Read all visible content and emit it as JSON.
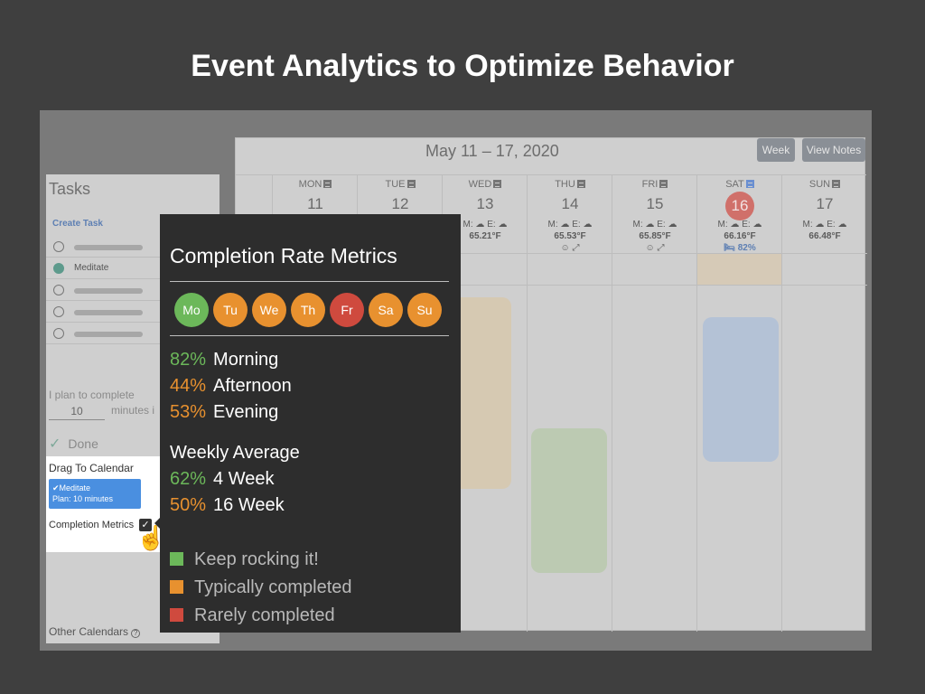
{
  "slide_title": "Event Analytics to Optimize Behavior",
  "colors": {
    "green": "#6cb85a",
    "orange": "#e8912f",
    "red": "#cf4a3e"
  },
  "calendar": {
    "title": "May 11 – 17, 2020",
    "week_button": "Week",
    "view_notes_button": "View Notes",
    "days": [
      {
        "name": "MON",
        "num": "11",
        "weather": "",
        "temp": "",
        "extra": ""
      },
      {
        "name": "TUE",
        "num": "12",
        "weather": "",
        "temp": "",
        "extra": ""
      },
      {
        "name": "WED",
        "num": "13",
        "weather": "M: ☁ E: ☁",
        "temp": "65.21°F",
        "extra": ""
      },
      {
        "name": "THU",
        "num": "14",
        "weather": "M: ☁ E: ☁",
        "temp": "65.53°F",
        "extra": "☺ ⤢"
      },
      {
        "name": "FRI",
        "num": "15",
        "weather": "M: ☁ E: ☁",
        "temp": "65.85°F",
        "extra": "☺ ⤢"
      },
      {
        "name": "SAT",
        "num": "16",
        "weather": "M: ☁ E: ☁",
        "temp": "66.16°F",
        "extra": "🛏 82%"
      },
      {
        "name": "SUN",
        "num": "17",
        "weather": "M: ☁ E: ☁",
        "temp": "66.48°F",
        "extra": ""
      }
    ]
  },
  "sidebar": {
    "title": "Tasks",
    "create_task": "Create Task",
    "task_item": "Meditate",
    "plan_text": "I plan to complete",
    "plan_value": "10",
    "plan_unit": "minutes i",
    "done": "Done",
    "drag_title": "Drag To Calendar",
    "drag_card_line1": "✔Meditate",
    "drag_card_line2": "Plan: 10 minutes",
    "completion_metrics": "Completion Metrics",
    "other_calendars": "Other Calendars"
  },
  "popup": {
    "title": "Completion Rate Metrics",
    "days": [
      {
        "label": "Mo",
        "status": "green"
      },
      {
        "label": "Tu",
        "status": "orange"
      },
      {
        "label": "We",
        "status": "orange"
      },
      {
        "label": "Th",
        "status": "orange"
      },
      {
        "label": "Fr",
        "status": "red"
      },
      {
        "label": "Sa",
        "status": "orange"
      },
      {
        "label": "Su",
        "status": "orange"
      }
    ],
    "morning_pct": "82%",
    "morning_label": "Morning",
    "afternoon_pct": "44%",
    "afternoon_label": "Afternoon",
    "evening_pct": "53%",
    "evening_label": "Evening",
    "weekly_title": "Weekly Average",
    "week4_pct": "62%",
    "week4_label": "4 Week",
    "week16_pct": "50%",
    "week16_label": "16 Week",
    "legend": [
      {
        "label": "Keep rocking it!",
        "status": "green"
      },
      {
        "label": "Typically completed",
        "status": "orange"
      },
      {
        "label": "Rarely completed",
        "status": "red"
      }
    ]
  }
}
